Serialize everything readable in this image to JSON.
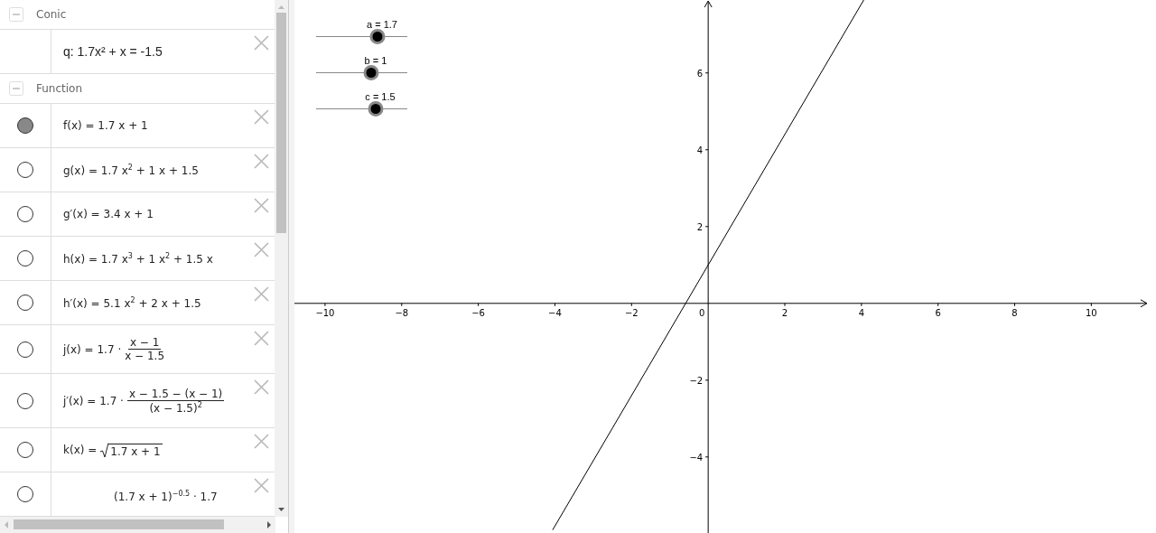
{
  "algebra_view": {
    "groups": [
      {
        "label": "Conic",
        "expanded": true,
        "rows": [
          {
            "kind": "conic",
            "text": "q: 1.7x² + x = -1.5"
          }
        ]
      },
      {
        "label": "Function",
        "expanded": true,
        "rows": [
          {
            "kind": "plain",
            "visible": true,
            "text": "f(x) = 1.7 x + 1"
          },
          {
            "kind": "plain",
            "visible": false,
            "text": "g(x) = 1.7 x$^{2}$ + 1 x + 1.5"
          },
          {
            "kind": "plain",
            "visible": false,
            "text": "g′(x) = 3.4 x + 1"
          },
          {
            "kind": "plain",
            "visible": false,
            "text": "h(x) = 1.7 x$^{3}$ + 1 x$^{2}$ + 1.5 x"
          },
          {
            "kind": "plain",
            "visible": false,
            "text": "h′(x) = 5.1 x$^{2}$ + 2 x + 1.5"
          },
          {
            "kind": "fraction",
            "visible": false,
            "lhs": "j(x) = 1.7 ·",
            "numerator": "x − 1",
            "denominator": "x − 1.5"
          },
          {
            "kind": "fraction",
            "visible": false,
            "lhs": "j′(x) = 1.7 ·",
            "numerator": "x − 1.5 − (x − 1)",
            "denominator": "(x − 1.5)$^{2}$"
          },
          {
            "kind": "root",
            "visible": false,
            "lhs": "k(x) =",
            "radicand": "1.7 x + 1"
          },
          {
            "kind": "fraction",
            "visible": false,
            "numerator": "(1.7 x + 1)$^{−0.5}$ · 1.7"
          }
        ]
      }
    ]
  },
  "graphics_view": {
    "sliders": [
      {
        "label": "a = 1.7",
        "level": 0.67
      },
      {
        "label": "b = 1",
        "level": 0.6
      },
      {
        "label": "c = 1.5",
        "level": 0.65
      }
    ],
    "chart_data": {
      "type": "line",
      "x": [
        -4.06,
        4.06
      ],
      "series": [
        {
          "color": "#000000",
          "values": [
            -5.9,
            7.9
          ]
        }
      ],
      "xlim": [
        -10.8,
        11.5
      ],
      "ylim": [
        -5.98,
        7.9
      ],
      "xticks": [
        {
          "value": -10,
          "label": "−10"
        },
        {
          "value": -8,
          "label": "−8"
        },
        {
          "value": -6,
          "label": "−6"
        },
        {
          "value": -4,
          "label": "−4"
        },
        {
          "value": -2,
          "label": "−2"
        },
        2,
        4,
        6,
        8,
        10
      ],
      "yticks": [
        {
          "value": -4,
          "label": "−4"
        },
        {
          "value": -2,
          "label": "−2"
        },
        2,
        4,
        6
      ]
    },
    "origin_label": "0"
  }
}
